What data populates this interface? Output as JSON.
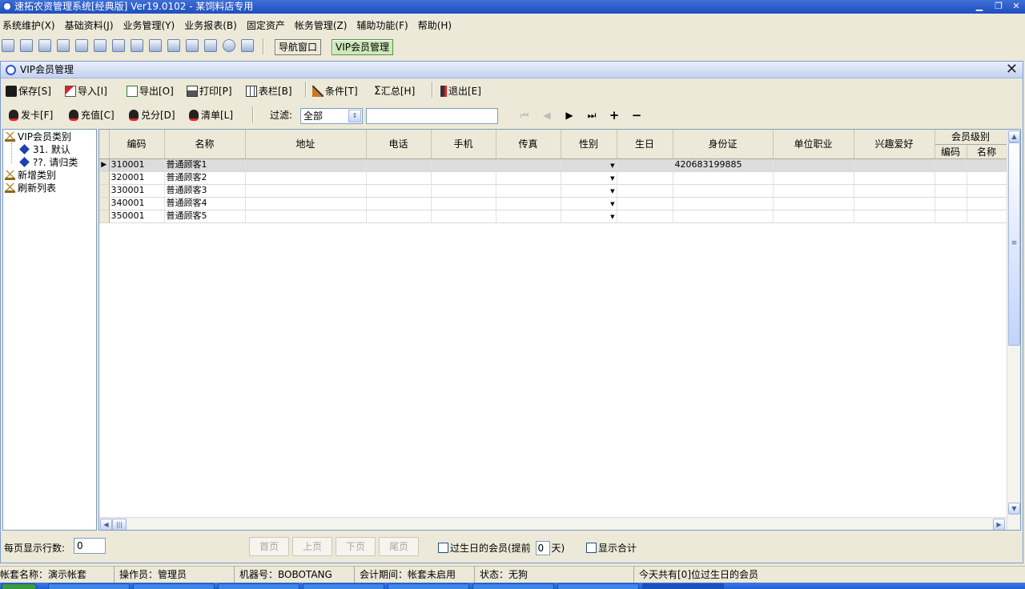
{
  "app": {
    "title": "速拓农资管理系统[经典版] Ver19.0102  -  某饲料店专用",
    "window_controls": {
      "minimize": "▁",
      "restore": "❐",
      "close": "✕"
    }
  },
  "menu": [
    "系统维护(X)",
    "基础资料(J)",
    "业务管理(Y)",
    "业务报表(B)",
    "固定资产",
    "帐务管理(Z)",
    "辅助功能(F)",
    "帮助(H)"
  ],
  "main_toolbar": {
    "nav_window": "导航窗口",
    "vip_manage": "VIP会员管理"
  },
  "child_window": {
    "title": "VIP会员管理",
    "close": "✕"
  },
  "action_toolbar": [
    {
      "label": "保存[S]",
      "icon": "save-icon"
    },
    {
      "label": "导入[I]",
      "icon": "import-icon"
    },
    {
      "label": "导出[O]",
      "icon": "excel-icon"
    },
    {
      "label": "打印[P]",
      "icon": "printer-icon"
    },
    {
      "label": "表栏[B]",
      "icon": "table-columns-icon"
    },
    {
      "label": "条件[T]",
      "icon": "filter-icon"
    },
    {
      "label": "汇总[H]",
      "icon": "sigma-icon"
    },
    {
      "label": "退出[E]",
      "icon": "exit-icon"
    }
  ],
  "card_toolbar": [
    {
      "label": "发卡[F]"
    },
    {
      "label": "充值[C]"
    },
    {
      "label": "兑分[D]"
    },
    {
      "label": "清单[L]"
    }
  ],
  "filter": {
    "label": "过滤:",
    "selected": "全部",
    "text_value": ""
  },
  "record_nav": {
    "first": "⏮",
    "prev": "◀",
    "next": "▶",
    "last": "⏭",
    "add": "+",
    "delete": "−"
  },
  "tree": {
    "root": "VIP会员类别",
    "children": [
      "31. 默认",
      "??. 请归类"
    ],
    "actions": [
      "新增类别",
      "刷新列表"
    ]
  },
  "grid": {
    "columns": [
      "编码",
      "名称",
      "地址",
      "电话",
      "手机",
      "传真",
      "性别",
      "生日",
      "身份证",
      "单位职业",
      "兴趣爱好"
    ],
    "group_header": "会员级别",
    "group_sub": [
      "编码",
      "名称"
    ],
    "rows": [
      {
        "code": "310001",
        "name": "普通顾客1",
        "id_card": "420683199885"
      },
      {
        "code": "320001",
        "name": "普通顾客2",
        "id_card": ""
      },
      {
        "code": "330001",
        "name": "普通顾客3",
        "id_card": ""
      },
      {
        "code": "340001",
        "name": "普通顾客4",
        "id_card": ""
      },
      {
        "code": "350001",
        "name": "普通顾客5",
        "id_card": ""
      }
    ],
    "selected_row_index": 0
  },
  "bottom_bar": {
    "rows_per_page_label": "每页显示行数:",
    "rows_per_page_value": "0",
    "first_page": "首页",
    "prev_page": "上页",
    "next_page": "下页",
    "last_page": "尾页",
    "birthday_label": "过生日的会员(提前",
    "birthday_days": "0",
    "birthday_suffix": "天)",
    "show_total": "显示合计"
  },
  "statusbar": {
    "account": "帐套名称：演示帐套",
    "operator": "操作员：管理员",
    "machine": "机器号：BOBOTANG",
    "period": "会计期间：帐套未启用",
    "state": "状态：无狗",
    "birthday_note": "今天共有[0]位过生日的会员"
  }
}
